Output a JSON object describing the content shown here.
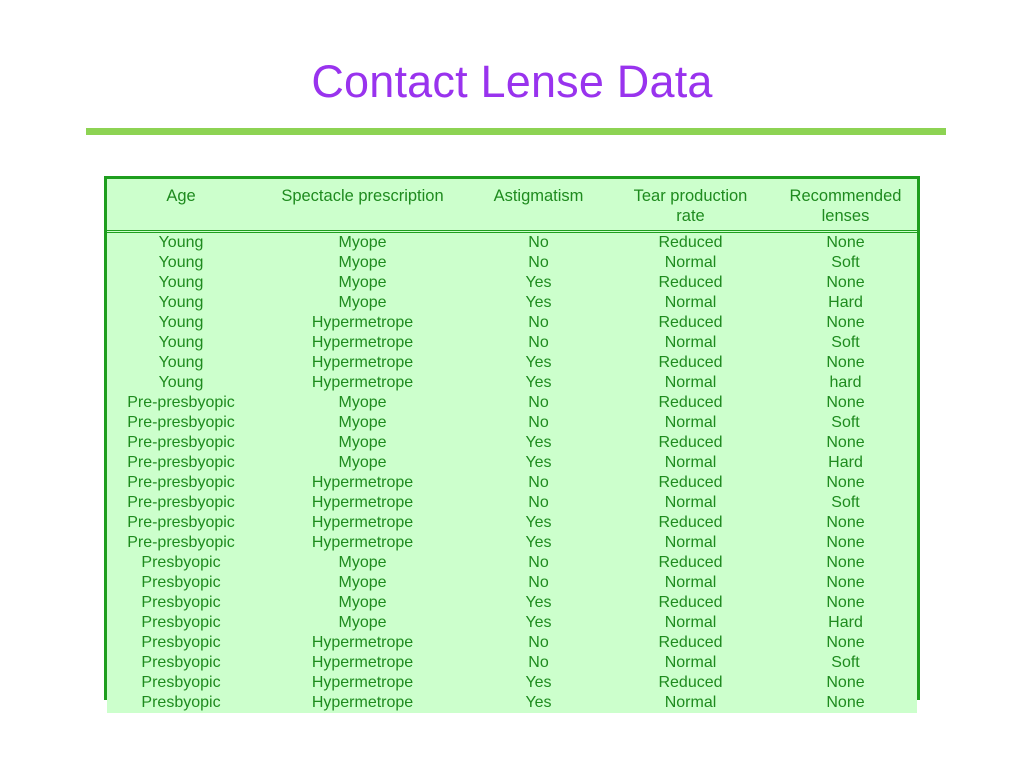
{
  "slide": {
    "title": "Contact Lense Data",
    "title_color": "#9933EE",
    "rule_color": "#8DD353",
    "table_border_color": "#1E9E1E",
    "table_bg_color": "#CCFFCC",
    "table_text_color": "#1E8B1E"
  },
  "table": {
    "headers": [
      {
        "line1": "Age",
        "line2": ""
      },
      {
        "line1": "Spectacle prescription",
        "line2": ""
      },
      {
        "line1": "Astigmatism",
        "line2": ""
      },
      {
        "line1": "Tear production",
        "line2": "rate"
      },
      {
        "line1": "Recommended",
        "line2": "lenses"
      }
    ],
    "rows": [
      [
        "Young",
        "Myope",
        "No",
        "Reduced",
        "None"
      ],
      [
        "Young",
        "Myope",
        "No",
        "Normal",
        "Soft"
      ],
      [
        "Young",
        "Myope",
        "Yes",
        "Reduced",
        "None"
      ],
      [
        "Young",
        "Myope",
        "Yes",
        "Normal",
        "Hard"
      ],
      [
        "Young",
        "Hypermetrope",
        "No",
        "Reduced",
        "None"
      ],
      [
        "Young",
        "Hypermetrope",
        "No",
        "Normal",
        "Soft"
      ],
      [
        "Young",
        "Hypermetrope",
        "Yes",
        "Reduced",
        "None"
      ],
      [
        "Young",
        "Hypermetrope",
        "Yes",
        "Normal",
        "hard"
      ],
      [
        "Pre-presbyopic",
        "Myope",
        "No",
        "Reduced",
        "None"
      ],
      [
        "Pre-presbyopic",
        "Myope",
        "No",
        "Normal",
        "Soft"
      ],
      [
        "Pre-presbyopic",
        "Myope",
        "Yes",
        "Reduced",
        "None"
      ],
      [
        "Pre-presbyopic",
        "Myope",
        "Yes",
        "Normal",
        "Hard"
      ],
      [
        "Pre-presbyopic",
        "Hypermetrope",
        "No",
        "Reduced",
        "None"
      ],
      [
        "Pre-presbyopic",
        "Hypermetrope",
        "No",
        "Normal",
        "Soft"
      ],
      [
        "Pre-presbyopic",
        "Hypermetrope",
        "Yes",
        "Reduced",
        "None"
      ],
      [
        "Pre-presbyopic",
        "Hypermetrope",
        "Yes",
        "Normal",
        "None"
      ],
      [
        "Presbyopic",
        "Myope",
        "No",
        "Reduced",
        "None"
      ],
      [
        "Presbyopic",
        "Myope",
        "No",
        "Normal",
        "None"
      ],
      [
        "Presbyopic",
        "Myope",
        "Yes",
        "Reduced",
        "None"
      ],
      [
        "Presbyopic",
        "Myope",
        "Yes",
        "Normal",
        "Hard"
      ],
      [
        "Presbyopic",
        "Hypermetrope",
        "No",
        "Reduced",
        "None"
      ],
      [
        "Presbyopic",
        "Hypermetrope",
        "No",
        "Normal",
        "Soft"
      ],
      [
        "Presbyopic",
        "Hypermetrope",
        "Yes",
        "Reduced",
        "None"
      ],
      [
        "Presbyopic",
        "Hypermetrope",
        "Yes",
        "Normal",
        "None"
      ]
    ]
  }
}
